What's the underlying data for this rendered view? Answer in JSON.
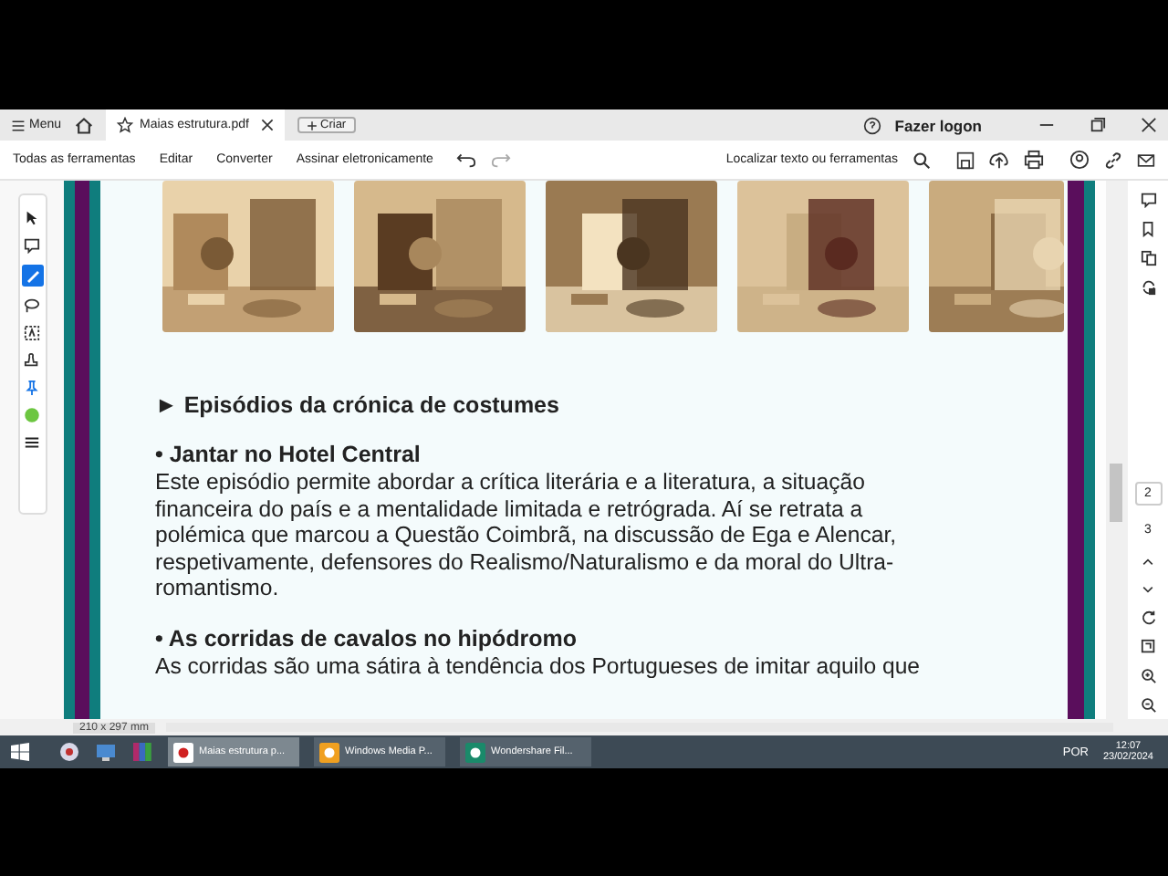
{
  "title_bar": {
    "menu": "Menu",
    "tab_title": "Maias estrutura.pdf",
    "new_tab": "Criar",
    "sign_in": "Fazer logon"
  },
  "toolbar": {
    "items": [
      "Todas as ferramentas",
      "Editar",
      "Converter",
      "Assinar eletronicamente"
    ],
    "search": "Localizar texto ou ferramentas"
  },
  "document": {
    "heading": "► Episódios da crónica de costumes",
    "sections": [
      {
        "title": "• Jantar no Hotel Central",
        "text": "Este episódio permite abordar a crítica literária e a literatura, a situação financeira do país e a mentalidade limitada e retrógrada. Aí se retrata a polémica que marcou a Questão Coimbrã, na discussão de Ega e Alencar, respetivamente, defensores do Realismo/Naturalismo e da moral do Ultra-romantismo."
      },
      {
        "title": "• As corridas de cavalos no hipódromo",
        "text": "As corridas são uma sátira à tendência dos Portugueses de imitar aquilo que"
      }
    ]
  },
  "page_nav": [
    {
      "label": "2",
      "selected": true
    },
    {
      "label": "3",
      "selected": false
    }
  ],
  "status": {
    "page_size": "210 x 297 mm"
  },
  "taskbar": {
    "apps": [
      {
        "label": "Maias estrutura p...",
        "active": true
      },
      {
        "label": "Windows Media P...",
        "active": false
      },
      {
        "label": "Wondershare Fil...",
        "active": false
      }
    ],
    "language": "POR",
    "time": "12:07",
    "date": "23/02/2024"
  }
}
